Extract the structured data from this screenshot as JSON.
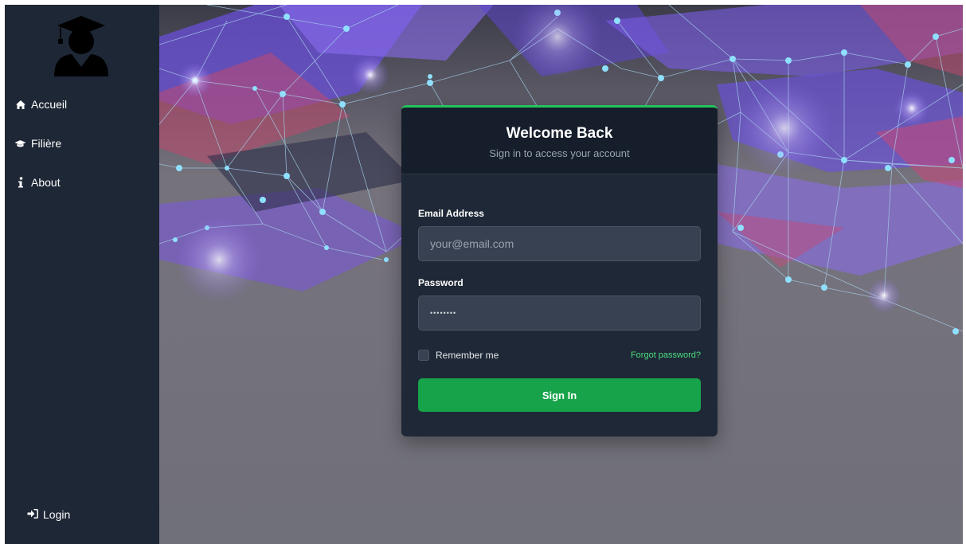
{
  "sidebar": {
    "logo_icon": "graduate-avatar-icon",
    "items": [
      {
        "label": "Accueil",
        "icon": "home-icon"
      },
      {
        "label": "Filière",
        "icon": "graduation-cap-icon"
      },
      {
        "label": "About",
        "icon": "info-icon"
      }
    ],
    "login": {
      "label": "Login",
      "icon": "sign-in-icon"
    }
  },
  "card": {
    "title": "Welcome Back",
    "subtitle": "Sign in to access your account",
    "email": {
      "label": "Email Address",
      "placeholder": "your@email.com",
      "value": ""
    },
    "password": {
      "label": "Password",
      "value": "••••••••"
    },
    "remember_label": "Remember me",
    "forgot_label": "Forgot password?",
    "submit_label": "Sign In"
  },
  "colors": {
    "sidebar_bg": "#1e2735",
    "card_bg": "#1f2836",
    "accent": "#22c55e",
    "button": "#16a34a",
    "link": "#4ade80"
  }
}
